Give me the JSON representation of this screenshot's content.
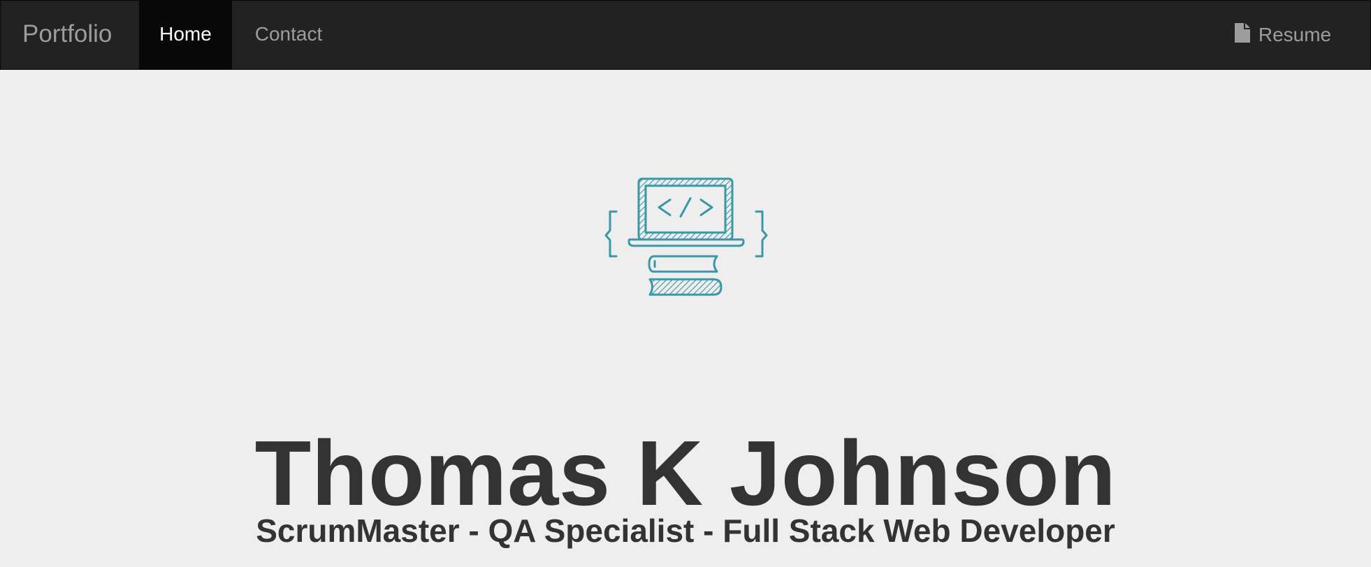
{
  "navbar": {
    "brand": "Portfolio",
    "links": [
      {
        "label": "Home",
        "active": true
      },
      {
        "label": "Contact",
        "active": false
      }
    ],
    "resume_label": "Resume",
    "resume_icon": "file-icon"
  },
  "hero": {
    "icon": "laptop-code-books-icon",
    "name": "Thomas K Johnson",
    "tagline": "ScrumMaster - QA Specialist - Full Stack Web Developer"
  },
  "colors": {
    "navbar_bg": "#222222",
    "navbar_active_bg": "#080808",
    "nav_text": "#9d9d9d",
    "nav_active_text": "#ffffff",
    "page_bg": "#eeeeee",
    "heading_text": "#333333",
    "icon_accent": "#3a97a5"
  }
}
